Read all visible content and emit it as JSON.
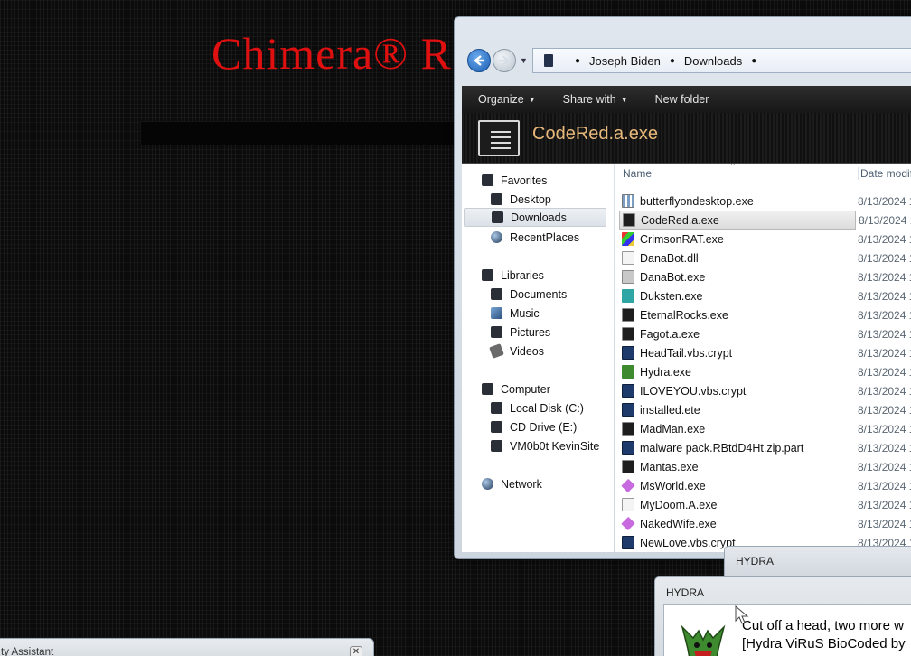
{
  "desktop": {
    "title_fragment": "Chimera® R"
  },
  "explorer": {
    "breadcrumb": [
      "Joseph Biden",
      "Downloads"
    ],
    "toolbar": {
      "organize": "Organize",
      "share_with": "Share with",
      "new_folder": "New folder"
    },
    "details_name": "CodeRed.a.exe",
    "columns": {
      "name": "Name",
      "date": "Date modif"
    },
    "nav": {
      "favorites": "Favorites",
      "desktop": "Desktop",
      "downloads": "Downloads",
      "recent_places": "RecentPlaces",
      "libraries": "Libraries",
      "documents": "Documents",
      "music": "Music",
      "pictures": "Pictures",
      "videos": "Videos",
      "computer": "Computer",
      "local_disk": "Local Disk (C:)",
      "cd_drive": "CD Drive (E:)",
      "vm_site": "VM0b0t KevinSite",
      "network": "Network"
    },
    "files": [
      {
        "name": "butterflyondesktop.exe",
        "date": "8/13/2024 1",
        "icon": "dots"
      },
      {
        "name": "CodeRed.a.exe",
        "date": "8/13/2024 1",
        "icon": "exe",
        "selected": true
      },
      {
        "name": "CrimsonRAT.exe",
        "date": "8/13/2024 1",
        "icon": "multi"
      },
      {
        "name": "DanaBot.dll",
        "date": "8/13/2024 1",
        "icon": "doc"
      },
      {
        "name": "DanaBot.exe",
        "date": "8/13/2024 1",
        "icon": "gray"
      },
      {
        "name": "Duksten.exe",
        "date": "8/13/2024 1",
        "icon": "teal"
      },
      {
        "name": "EternalRocks.exe",
        "date": "8/13/2024 1",
        "icon": "exe"
      },
      {
        "name": "Fagot.a.exe",
        "date": "8/13/2024 1",
        "icon": "exe"
      },
      {
        "name": "HeadTail.vbs.crypt",
        "date": "8/13/2024 1",
        "icon": "crypt"
      },
      {
        "name": "Hydra.exe",
        "date": "8/13/2024 1",
        "icon": "green"
      },
      {
        "name": "ILOVEYOU.vbs.crypt",
        "date": "8/13/2024 1",
        "icon": "crypt"
      },
      {
        "name": "installed.ete",
        "date": "8/13/2024 1",
        "icon": "crypt"
      },
      {
        "name": "MadMan.exe",
        "date": "8/13/2024 1",
        "icon": "exe"
      },
      {
        "name": "malware pack.RBtdD4Ht.zip.part",
        "date": "8/13/2024 1",
        "icon": "crypt"
      },
      {
        "name": "Mantas.exe",
        "date": "8/13/2024 1",
        "icon": "exe"
      },
      {
        "name": "MsWorld.exe",
        "date": "8/13/2024 1",
        "icon": "pink"
      },
      {
        "name": "MyDoom.A.exe",
        "date": "8/13/2024 1",
        "icon": "doc"
      },
      {
        "name": "NakedWife.exe",
        "date": "8/13/2024 1",
        "icon": "pink"
      },
      {
        "name": "NewLove.vbs.crypt",
        "date": "8/13/2024 1",
        "icon": "crypt"
      }
    ]
  },
  "hydra_back": {
    "title": "HYDRA"
  },
  "hydra_front": {
    "title": "HYDRA",
    "message_line1": "Cut off a head, two more w",
    "message_line2": "[Hydra ViRuS BioCoded by"
  },
  "assistant": {
    "title": "ty Assistant",
    "close": "✕"
  }
}
